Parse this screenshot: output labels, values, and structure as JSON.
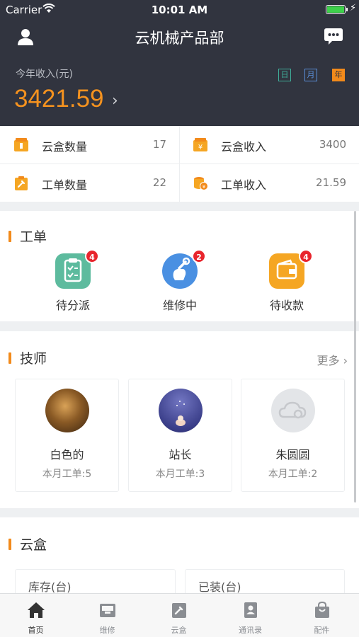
{
  "status_bar": {
    "carrier": "Carrier",
    "time": "10:01 AM"
  },
  "nav": {
    "title": "云机械产品部",
    "left_icon": "user-icon",
    "right_icon": "chat-icon"
  },
  "income": {
    "label": "今年收入(元)",
    "value": "3421.59",
    "ranges": [
      "日",
      "月",
      "年"
    ],
    "selected_range": "年"
  },
  "stats": [
    {
      "label": "云盒数量",
      "value": "17",
      "icon": "box-icon"
    },
    {
      "label": "云盒收入",
      "value": "3400",
      "icon": "box-yen-icon"
    },
    {
      "label": "工单数量",
      "value": "22",
      "icon": "clipboard-wrench-icon"
    },
    {
      "label": "工单收入",
      "value": "21.59",
      "icon": "coins-icon"
    }
  ],
  "work_orders": {
    "title": "工单",
    "items": [
      {
        "label": "待分派",
        "badge": "4",
        "icon": "clipboard-check-icon",
        "color": "#5dbb9e"
      },
      {
        "label": "维修中",
        "badge": "2",
        "icon": "wrench-hand-icon",
        "color": "#4a90e2"
      },
      {
        "label": "待收款",
        "badge": "4",
        "icon": "wallet-icon",
        "color": "#f5a623"
      }
    ]
  },
  "technicians": {
    "title": "技师",
    "more": "更多",
    "items": [
      {
        "name": "白色的",
        "count_label": "本月工单:5"
      },
      {
        "name": "站长",
        "count_label": "本月工单:3"
      },
      {
        "name": "朱圆圆",
        "count_label": "本月工单:2"
      }
    ]
  },
  "cloud_box": {
    "title": "云盒",
    "stock_label": "库存(台)",
    "installed_label": "已装(台)"
  },
  "tabs": [
    {
      "label": "首页",
      "icon": "home-icon",
      "active": true
    },
    {
      "label": "维修",
      "icon": "inbox-icon",
      "active": false
    },
    {
      "label": "云盒",
      "icon": "cloud-box-icon",
      "active": false
    },
    {
      "label": "通讯录",
      "icon": "contacts-icon",
      "active": false
    },
    {
      "label": "配件",
      "icon": "bag-icon",
      "active": false
    }
  ],
  "colors": {
    "header_bg": "#31343f",
    "accent": "#f28a1b",
    "badge": "#e8252d"
  }
}
